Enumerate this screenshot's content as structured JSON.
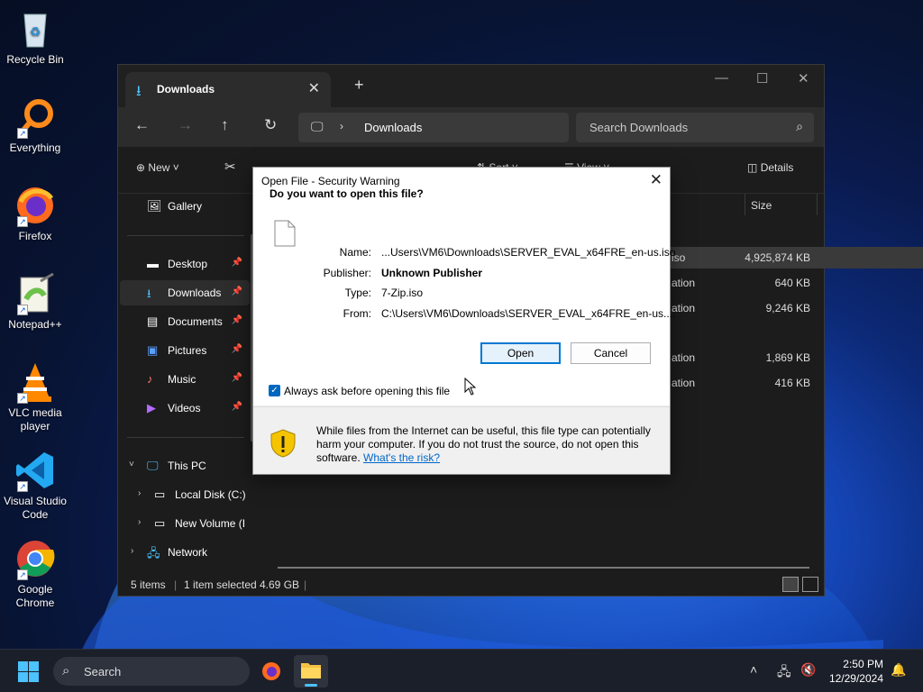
{
  "desktop": {
    "icons": [
      {
        "label": "Recycle Bin"
      },
      {
        "label": "Everything"
      },
      {
        "label": "Firefox"
      },
      {
        "label": "Notepad++"
      },
      {
        "label": "VLC media player"
      },
      {
        "label": "Visual Studio Code"
      },
      {
        "label": "Google Chrome"
      }
    ]
  },
  "explorer": {
    "tab": {
      "label": "Downloads",
      "icon": "download-icon"
    },
    "address": {
      "crumb": "Downloads"
    },
    "search": {
      "placeholder": "Search Downloads"
    },
    "commands": {
      "new": "New",
      "sort": "Sort",
      "view": "View",
      "details": "Details"
    },
    "nav": {
      "gallery": "Gallery",
      "desktop": "Desktop",
      "downloads": "Downloads",
      "documents": "Documents",
      "pictures": "Pictures",
      "music": "Music",
      "videos": "Videos",
      "this_pc": "This PC",
      "local_disk": "Local Disk (C:)",
      "new_volume": "New Volume (I",
      "network": "Network"
    },
    "columns": {
      "size": "Size"
    },
    "rows": [
      {
        "type": "iso",
        "size": "4,925,874 KB"
      },
      {
        "type": "ation",
        "size": "640 KB"
      },
      {
        "type": "ation",
        "size": "9,246 KB"
      },
      {
        "type": "ation",
        "size": "1,869 KB"
      },
      {
        "type": "ation",
        "size": "416 KB"
      }
    ],
    "status": {
      "count": "5 items",
      "selected": "1 item selected",
      "size": "4.69 GB"
    }
  },
  "dialog": {
    "title": "Open File - Security Warning",
    "question": "Do you want to open this file?",
    "labels": {
      "name": "Name:",
      "publisher": "Publisher:",
      "type": "Type:",
      "from": "From:"
    },
    "values": {
      "name": "...Users\\VM6\\Downloads\\SERVER_EVAL_x64FRE_en-us.iso",
      "publisher": "Unknown Publisher",
      "type": "7-Zip.iso",
      "from": "C:\\Users\\VM6\\Downloads\\SERVER_EVAL_x64FRE_en-us...."
    },
    "open_label": "Open",
    "cancel_label": "Cancel",
    "checkbox_label": "Always ask before opening this file",
    "checkbox_checked": true,
    "warning": "While files from the Internet can be useful, this file type can potentially harm your computer. If you do not trust the source, do not open this software.",
    "risk_link": "What's the risk?"
  },
  "taskbar": {
    "search_label": "Search",
    "time": "2:50 PM",
    "date": "12/29/2024"
  },
  "colors": {
    "accent": "#0067c0",
    "taskbar": "#1b1f2a",
    "explorer_bg": "#1c1c1c"
  }
}
